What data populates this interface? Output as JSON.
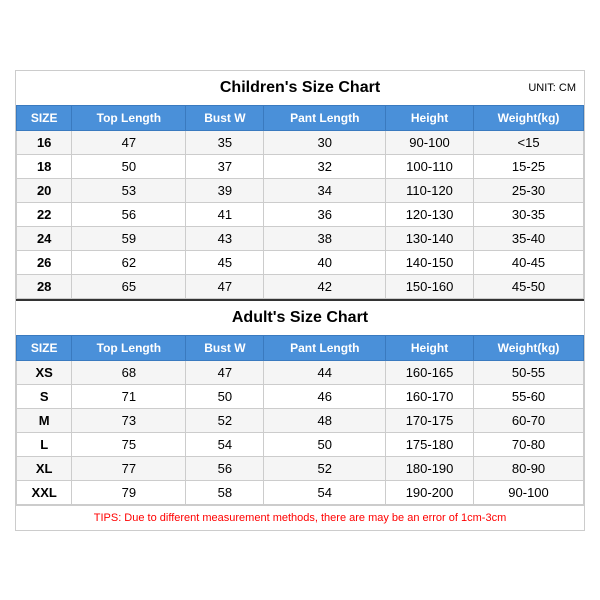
{
  "children_title": "Children's Size Chart",
  "adult_title": "Adult's Size Chart",
  "unit": "UNIT: CM",
  "tips": "TIPS: Due to different measurement methods, there are may be an error of 1cm-3cm",
  "columns": [
    "SIZE",
    "Top Length",
    "Bust W",
    "Pant Length",
    "Height",
    "Weight(kg)"
  ],
  "children_rows": [
    [
      "16",
      "47",
      "35",
      "30",
      "90-100",
      "<15"
    ],
    [
      "18",
      "50",
      "37",
      "32",
      "100-110",
      "15-25"
    ],
    [
      "20",
      "53",
      "39",
      "34",
      "110-120",
      "25-30"
    ],
    [
      "22",
      "56",
      "41",
      "36",
      "120-130",
      "30-35"
    ],
    [
      "24",
      "59",
      "43",
      "38",
      "130-140",
      "35-40"
    ],
    [
      "26",
      "62",
      "45",
      "40",
      "140-150",
      "40-45"
    ],
    [
      "28",
      "65",
      "47",
      "42",
      "150-160",
      "45-50"
    ]
  ],
  "adult_rows": [
    [
      "XS",
      "68",
      "47",
      "44",
      "160-165",
      "50-55"
    ],
    [
      "S",
      "71",
      "50",
      "46",
      "160-170",
      "55-60"
    ],
    [
      "M",
      "73",
      "52",
      "48",
      "170-175",
      "60-70"
    ],
    [
      "L",
      "75",
      "54",
      "50",
      "175-180",
      "70-80"
    ],
    [
      "XL",
      "77",
      "56",
      "52",
      "180-190",
      "80-90"
    ],
    [
      "XXL",
      "79",
      "58",
      "54",
      "190-200",
      "90-100"
    ]
  ]
}
